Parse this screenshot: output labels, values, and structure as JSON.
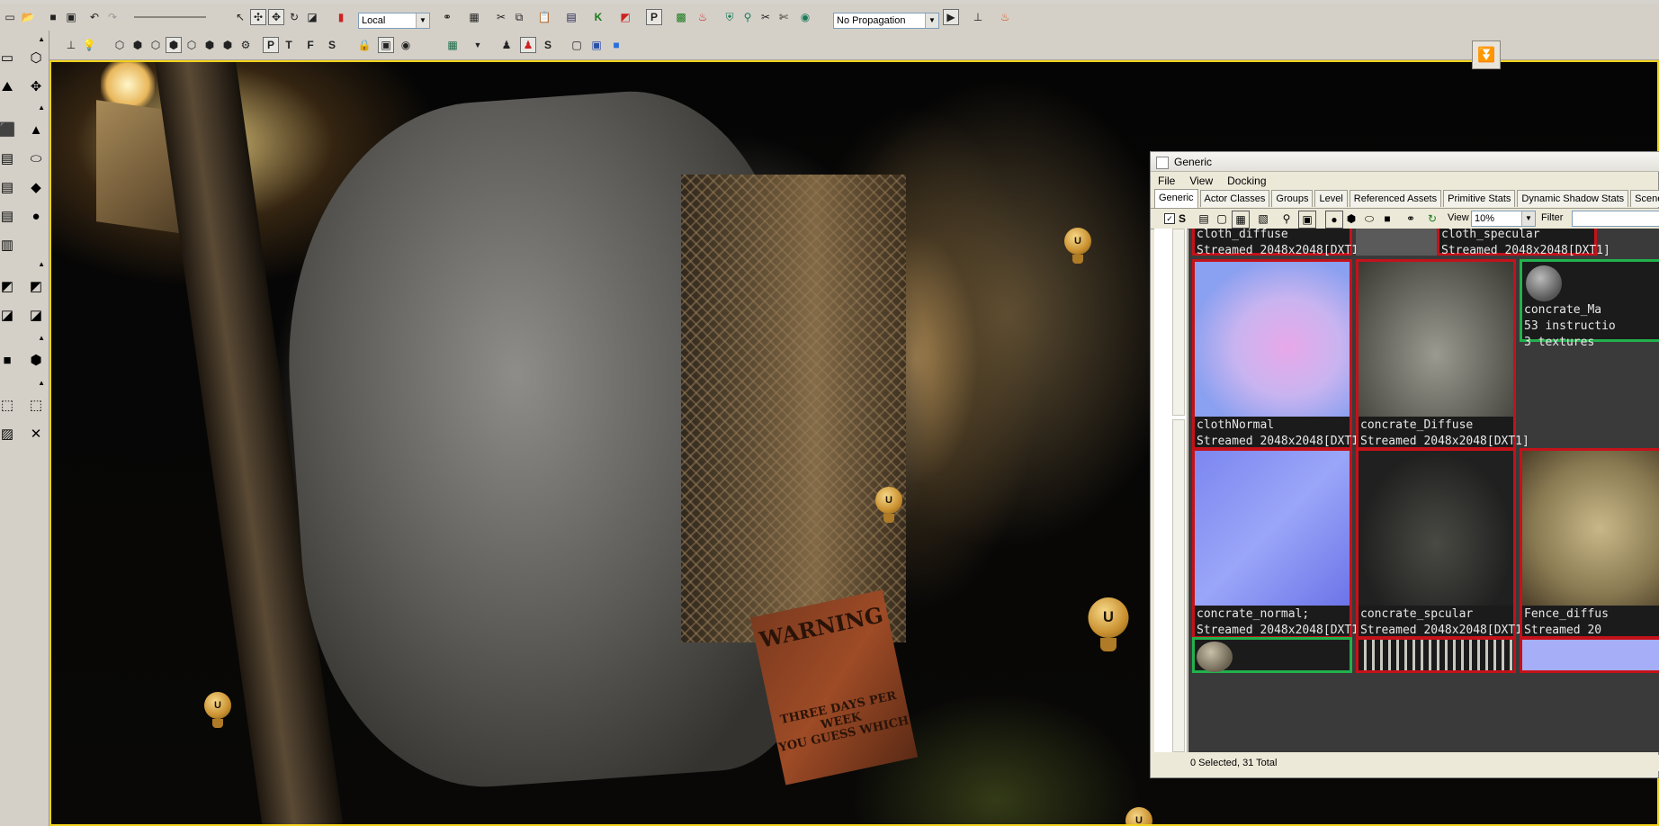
{
  "toolbar": {
    "coordinate_system": "Local",
    "propagation": "No Propagation",
    "mode_letters": [
      "P",
      "T",
      "F",
      "S"
    ],
    "tool_letter_s": "S"
  },
  "generic_browser": {
    "title": "Generic",
    "menu": [
      "File",
      "View",
      "Docking"
    ],
    "tabs": [
      "Generic",
      "Actor Classes",
      "Groups",
      "Level",
      "Referenced Assets",
      "Primitive Stats",
      "Dynamic Shadow Stats",
      "Scene M"
    ],
    "active_tab": "Generic",
    "view_label": "View",
    "zoom": "10%",
    "filter_label": "Filter",
    "left_label": "S",
    "thumbnails": [
      {
        "name": "cloth_diffuse",
        "info": "Streamed 2048x2048[DXT1]",
        "type": "texture"
      },
      {
        "name": "",
        "info": "",
        "type": "texture"
      },
      {
        "name": "cloth_specular",
        "info": "Streamed 2048x2048[DXT1]",
        "type": "texture"
      },
      {
        "name": "clothNormal",
        "info": "Streamed 2048x2048[DXT1]",
        "type": "texture"
      },
      {
        "name": "concrate_Diffuse",
        "info": "Streamed 2048x2048[DXT1]",
        "type": "texture"
      },
      {
        "name": "concrate_Ma",
        "info": "53 instructio",
        "info2": "3 textures",
        "type": "material"
      },
      {
        "name": "concrate_normal;",
        "info": "Streamed 2048x2048[DXT1]",
        "type": "texture"
      },
      {
        "name": "concrate_spcular",
        "info": "Streamed 2048x2048[DXT1]",
        "type": "texture"
      },
      {
        "name": "Fence_diffus",
        "info": "Streamed 20",
        "type": "texture"
      }
    ],
    "status": "0 Selected, 31 Total"
  },
  "viewport": {
    "sign_text": "WARNING",
    "sign_lines": [
      "THREE DAYS PER WEEK",
      "YOU GUESS WHICH"
    ],
    "light_icon_letter": "U"
  },
  "colors": {
    "viewport_border": "#f1d21c",
    "selected_border": "#c4121a",
    "material_border": "#22b14c"
  }
}
